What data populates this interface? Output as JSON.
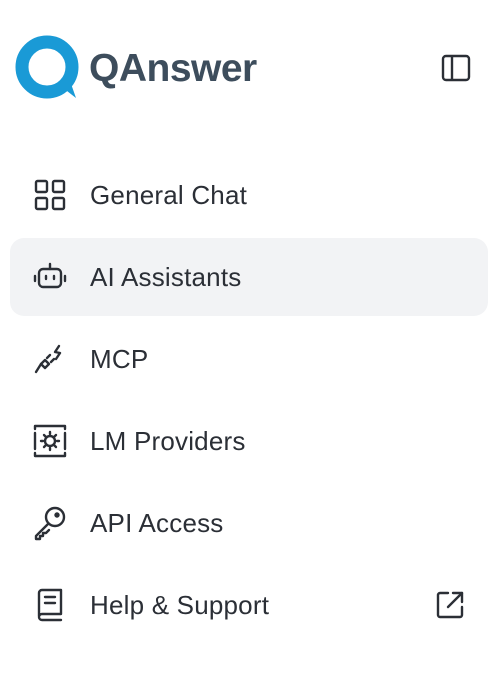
{
  "brand": {
    "name": "QAnswer",
    "logo_icon": "qanswer-logo-icon",
    "accent_color": "#1a9ad6"
  },
  "header": {
    "collapse_icon": "sidebar-toggle-icon"
  },
  "nav": {
    "active_index": 1,
    "items": [
      {
        "label": "General Chat",
        "icon": "grid-icon"
      },
      {
        "label": "AI Assistants",
        "icon": "robot-icon"
      },
      {
        "label": "MCP",
        "icon": "plug-icon"
      },
      {
        "label": "LM Providers",
        "icon": "server-gear-icon"
      },
      {
        "label": "API Access",
        "icon": "key-icon"
      },
      {
        "label": "Help & Support",
        "icon": "book-icon",
        "trailing_icon": "external-link-icon"
      }
    ]
  },
  "colors": {
    "text": "#2b2f36",
    "active_bg": "#f2f3f5",
    "brand_text": "#3d4d5c"
  }
}
